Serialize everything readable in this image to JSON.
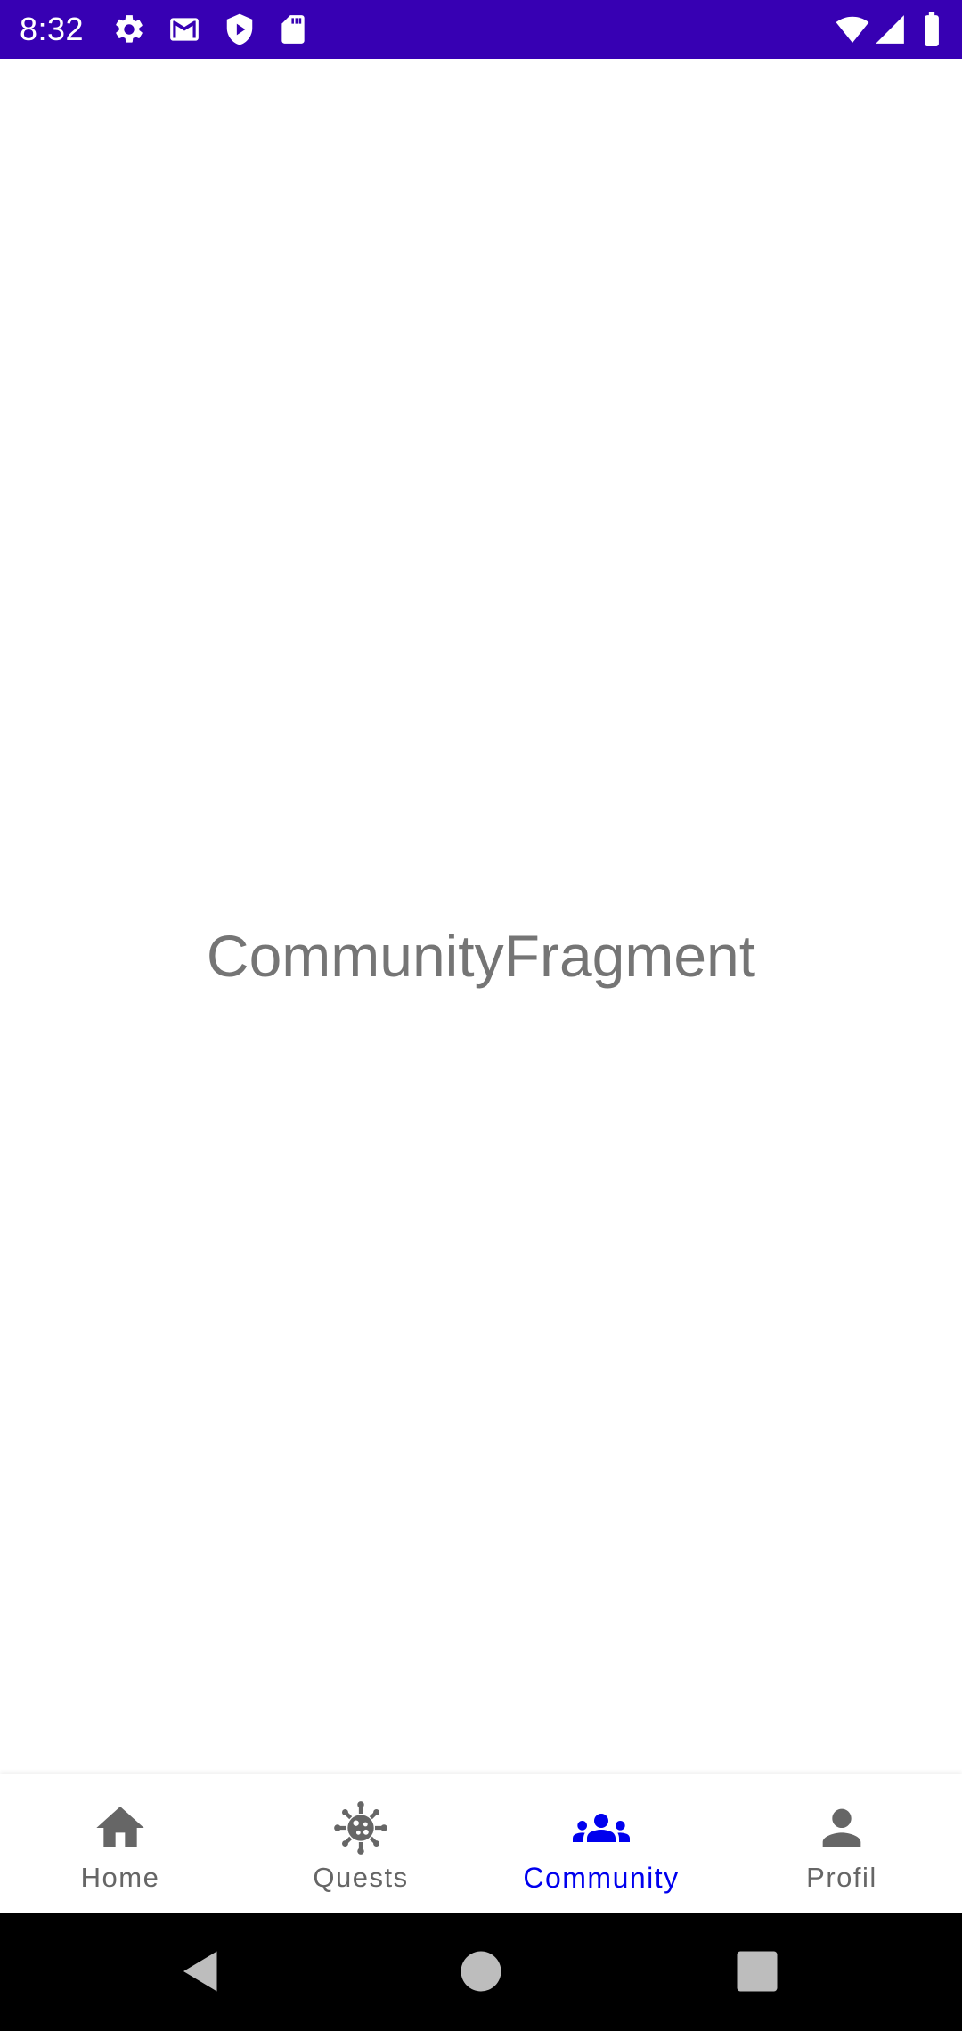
{
  "status_bar": {
    "time": "8:32",
    "background": "#3700b3",
    "left_icons": [
      "settings-icon",
      "gmail-icon",
      "shield-play-icon",
      "sd-card-icon"
    ],
    "right_icons": [
      "wifi-icon",
      "cell-signal-icon",
      "battery-icon"
    ]
  },
  "content": {
    "text": "CommunityFragment",
    "text_color": "#757575"
  },
  "bottom_nav": {
    "active_color": "#0000ee",
    "inactive_color": "#666666",
    "items": [
      {
        "label": "Home",
        "icon": "home-icon",
        "active": false
      },
      {
        "label": "Quests",
        "icon": "virus-icon",
        "active": false
      },
      {
        "label": "Community",
        "icon": "group-icon",
        "active": true
      },
      {
        "label": "Profil",
        "icon": "person-icon",
        "active": false
      }
    ]
  },
  "system_nav": {
    "buttons": [
      "back-button",
      "home-button",
      "recents-button"
    ]
  }
}
